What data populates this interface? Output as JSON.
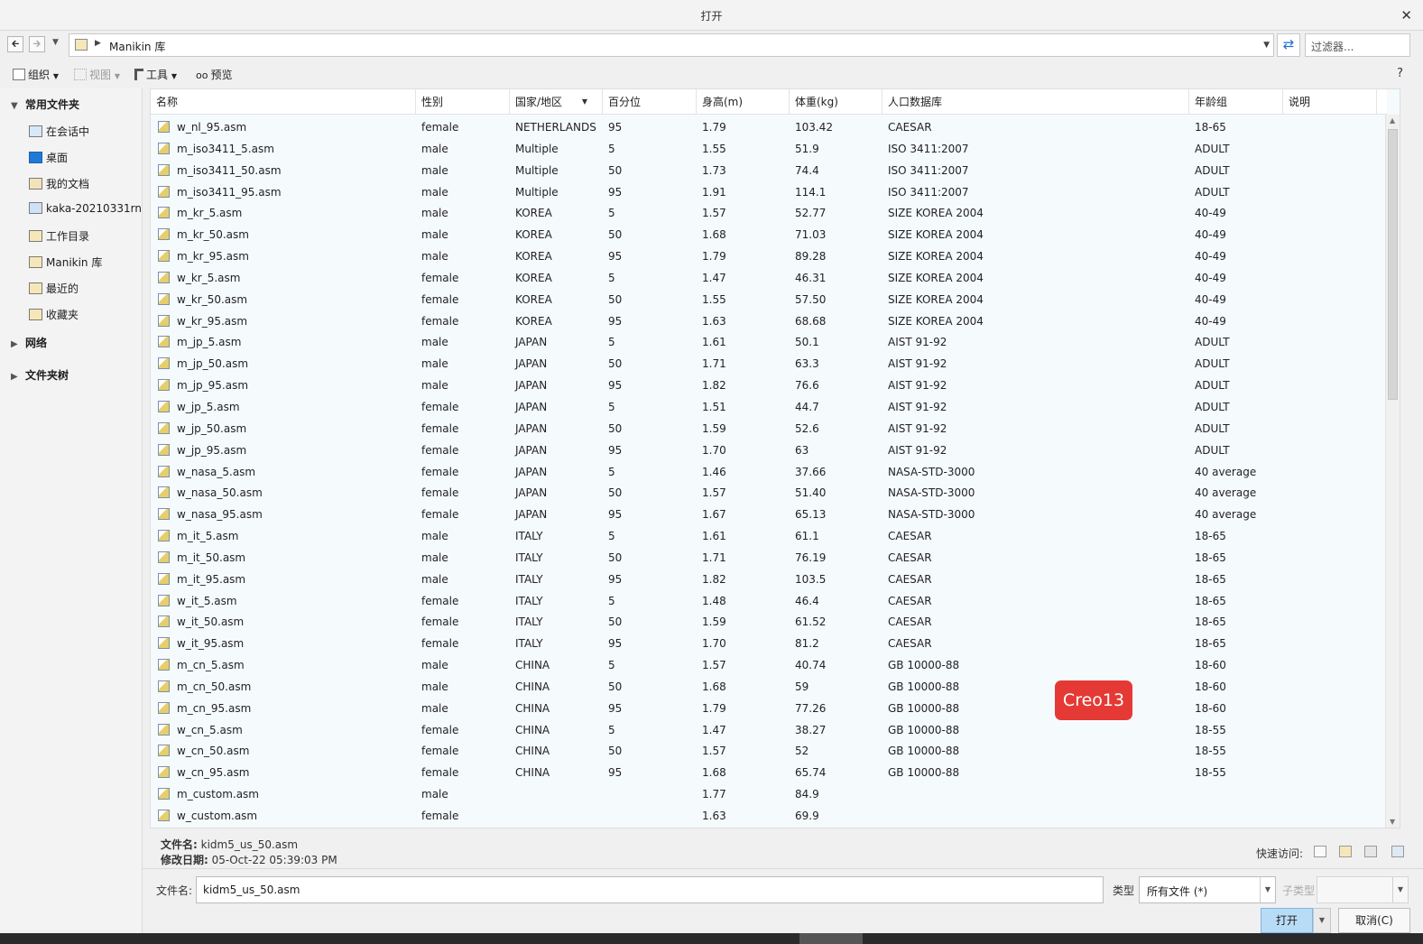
{
  "window": {
    "title": "打开",
    "close_glyph": "✕"
  },
  "nav": {
    "back_glyph": "🡰",
    "forward_glyph": "🡲",
    "history_glyph": "▼",
    "breadcrumb_sep": "▶",
    "path": "Manikin 库",
    "dropdown_glyph": "▼",
    "refresh_glyph": "⇄",
    "filter_placeholder": "过滤器..."
  },
  "toolbar": {
    "organize": "组织",
    "view": "视图",
    "tools": "工具",
    "preview": "预览",
    "help_glyph": "?"
  },
  "sidebar": {
    "favorites_label": "常用文件夹",
    "items": [
      {
        "label": "在会话中",
        "icon": "monitor-icon"
      },
      {
        "label": "桌面",
        "icon": "desktop-icon"
      },
      {
        "label": "我的文档",
        "icon": "documents-icon"
      },
      {
        "label": "kaka-20210331rn",
        "icon": "computer-icon"
      },
      {
        "label": "工作目录",
        "icon": "working-folder-icon"
      },
      {
        "label": "Manikin 库",
        "icon": "library-folder-icon"
      },
      {
        "label": "最近的",
        "icon": "recent-icon"
      },
      {
        "label": "收藏夹",
        "icon": "favorites-icon"
      }
    ],
    "network_label": "网络",
    "tree_label": "文件夹树",
    "expanded_glyph": "▼",
    "collapsed_glyph": "▶"
  },
  "table": {
    "columns": [
      "名称",
      "性别",
      "国家/地区",
      "百分位",
      "身高(m)",
      "体重(kg)",
      "人口数据库",
      "年龄组",
      "说明"
    ],
    "sort_glyph": "▼",
    "rows": [
      [
        "w_nl_95.asm",
        "female",
        "NETHERLANDS",
        "95",
        "1.79",
        "103.42",
        "CAESAR",
        "18-65",
        ""
      ],
      [
        "m_iso3411_5.asm",
        "male",
        "Multiple",
        "5",
        "1.55",
        "51.9",
        "ISO 3411:2007",
        "ADULT",
        ""
      ],
      [
        "m_iso3411_50.asm",
        "male",
        "Multiple",
        "50",
        "1.73",
        "74.4",
        "ISO 3411:2007",
        "ADULT",
        ""
      ],
      [
        "m_iso3411_95.asm",
        "male",
        "Multiple",
        "95",
        "1.91",
        "114.1",
        "ISO 3411:2007",
        "ADULT",
        ""
      ],
      [
        "m_kr_5.asm",
        "male",
        "KOREA",
        "5",
        "1.57",
        "52.77",
        "SIZE KOREA 2004",
        "40-49",
        ""
      ],
      [
        "m_kr_50.asm",
        "male",
        "KOREA",
        "50",
        "1.68",
        "71.03",
        "SIZE KOREA 2004",
        "40-49",
        ""
      ],
      [
        "m_kr_95.asm",
        "male",
        "KOREA",
        "95",
        "1.79",
        "89.28",
        "SIZE KOREA 2004",
        "40-49",
        ""
      ],
      [
        "w_kr_5.asm",
        "female",
        "KOREA",
        "5",
        "1.47",
        "46.31",
        "SIZE KOREA 2004",
        "40-49",
        ""
      ],
      [
        "w_kr_50.asm",
        "female",
        "KOREA",
        "50",
        "1.55",
        "57.50",
        "SIZE KOREA 2004",
        "40-49",
        ""
      ],
      [
        "w_kr_95.asm",
        "female",
        "KOREA",
        "95",
        "1.63",
        "68.68",
        "SIZE KOREA 2004",
        "40-49",
        ""
      ],
      [
        "m_jp_5.asm",
        "male",
        "JAPAN",
        "5",
        "1.61",
        "50.1",
        "AIST 91-92",
        "ADULT",
        ""
      ],
      [
        "m_jp_50.asm",
        "male",
        "JAPAN",
        "50",
        "1.71",
        "63.3",
        "AIST 91-92",
        "ADULT",
        ""
      ],
      [
        "m_jp_95.asm",
        "male",
        "JAPAN",
        "95",
        "1.82",
        "76.6",
        "AIST 91-92",
        "ADULT",
        ""
      ],
      [
        "w_jp_5.asm",
        "female",
        "JAPAN",
        "5",
        "1.51",
        "44.7",
        "AIST 91-92",
        "ADULT",
        ""
      ],
      [
        "w_jp_50.asm",
        "female",
        "JAPAN",
        "50",
        "1.59",
        "52.6",
        "AIST 91-92",
        "ADULT",
        ""
      ],
      [
        "w_jp_95.asm",
        "female",
        "JAPAN",
        "95",
        "1.70",
        "63",
        "AIST 91-92",
        "ADULT",
        ""
      ],
      [
        "w_nasa_5.asm",
        "female",
        "JAPAN",
        "5",
        "1.46",
        "37.66",
        "NASA-STD-3000",
        "40 average",
        ""
      ],
      [
        "w_nasa_50.asm",
        "female",
        "JAPAN",
        "50",
        "1.57",
        "51.40",
        "NASA-STD-3000",
        "40 average",
        ""
      ],
      [
        "w_nasa_95.asm",
        "female",
        "JAPAN",
        "95",
        "1.67",
        "65.13",
        "NASA-STD-3000",
        "40 average",
        ""
      ],
      [
        "m_it_5.asm",
        "male",
        "ITALY",
        "5",
        "1.61",
        "61.1",
        "CAESAR",
        "18-65",
        ""
      ],
      [
        "m_it_50.asm",
        "male",
        "ITALY",
        "50",
        "1.71",
        "76.19",
        "CAESAR",
        "18-65",
        ""
      ],
      [
        "m_it_95.asm",
        "male",
        "ITALY",
        "95",
        "1.82",
        "103.5",
        "CAESAR",
        "18-65",
        ""
      ],
      [
        "w_it_5.asm",
        "female",
        "ITALY",
        "5",
        "1.48",
        "46.4",
        "CAESAR",
        "18-65",
        ""
      ],
      [
        "w_it_50.asm",
        "female",
        "ITALY",
        "50",
        "1.59",
        "61.52",
        "CAESAR",
        "18-65",
        ""
      ],
      [
        "w_it_95.asm",
        "female",
        "ITALY",
        "95",
        "1.70",
        "81.2",
        "CAESAR",
        "18-65",
        ""
      ],
      [
        "m_cn_5.asm",
        "male",
        "CHINA",
        "5",
        "1.57",
        "40.74",
        "GB 10000-88",
        "18-60",
        ""
      ],
      [
        "m_cn_50.asm",
        "male",
        "CHINA",
        "50",
        "1.68",
        "59",
        "GB 10000-88",
        "18-60",
        ""
      ],
      [
        "m_cn_95.asm",
        "male",
        "CHINA",
        "95",
        "1.79",
        "77.26",
        "GB 10000-88",
        "18-60",
        ""
      ],
      [
        "w_cn_5.asm",
        "female",
        "CHINA",
        "5",
        "1.47",
        "38.27",
        "GB 10000-88",
        "18-55",
        ""
      ],
      [
        "w_cn_50.asm",
        "female",
        "CHINA",
        "50",
        "1.57",
        "52",
        "GB 10000-88",
        "18-55",
        ""
      ],
      [
        "w_cn_95.asm",
        "female",
        "CHINA",
        "95",
        "1.68",
        "65.74",
        "GB 10000-88",
        "18-55",
        ""
      ],
      [
        "m_custom.asm",
        "male",
        "",
        "",
        "1.77",
        "84.9",
        "",
        "",
        ""
      ],
      [
        "w_custom.asm",
        "female",
        "",
        "",
        "1.63",
        "69.9",
        "",
        "",
        ""
      ]
    ],
    "scroll_up_glyph": "▲",
    "scroll_down_glyph": "▼"
  },
  "watermark": {
    "text": "Creo13",
    "color": "#e53935"
  },
  "details": {
    "file_name_label": "文件名:",
    "file_name_value": "kidm5_us_50.asm",
    "modified_label": "修改日期:",
    "modified_value": "05-Oct-22 05:39:03 PM",
    "quick_access_label": "快速访问:"
  },
  "footer": {
    "file_name_label": "文件名:",
    "file_name_value": "kidm5_us_50.asm",
    "type_label": "类型",
    "type_value": "所有文件 (*)",
    "subtype_label": "子类型",
    "dropdown_glyph": "▼",
    "open_button": "打开",
    "cancel_button": "取消(C)"
  },
  "colors": {
    "accent": "#1d6fd3",
    "selected_button": "#b9dcf6",
    "list_bg": "#f5fafd"
  }
}
